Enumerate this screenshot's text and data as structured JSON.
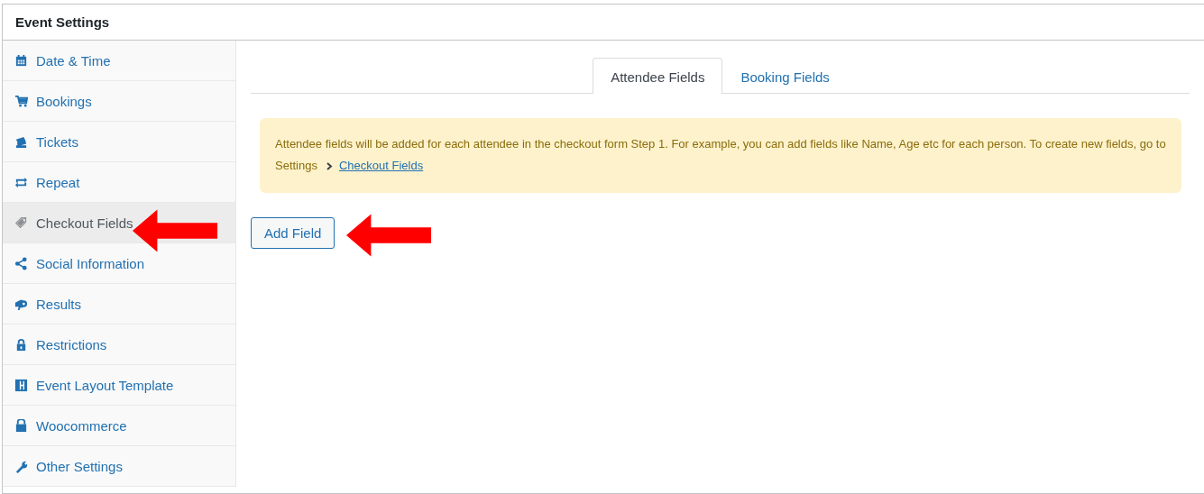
{
  "panel": {
    "title": "Event Settings"
  },
  "sidebar": {
    "items": [
      {
        "label": "Date & Time",
        "selected": false
      },
      {
        "label": "Bookings",
        "selected": false
      },
      {
        "label": "Tickets",
        "selected": false
      },
      {
        "label": "Repeat",
        "selected": false
      },
      {
        "label": "Checkout Fields",
        "selected": true
      },
      {
        "label": "Social Information",
        "selected": false
      },
      {
        "label": "Results",
        "selected": false
      },
      {
        "label": "Restrictions",
        "selected": false
      },
      {
        "label": "Event Layout Template",
        "selected": false
      },
      {
        "label": "Woocommerce",
        "selected": false
      },
      {
        "label": "Other Settings",
        "selected": false
      }
    ]
  },
  "tabs": [
    {
      "label": "Attendee Fields",
      "selected": true
    },
    {
      "label": "Booking Fields",
      "selected": false
    }
  ],
  "notice": {
    "text": "Attendee fields will be added for each attendee in the checkout form Step 1. For example, you can add fields like Name, Age etc for each person. To create new fields, go to Settings",
    "link": "Checkout Fields"
  },
  "add_button": {
    "label": "Add Field"
  }
}
